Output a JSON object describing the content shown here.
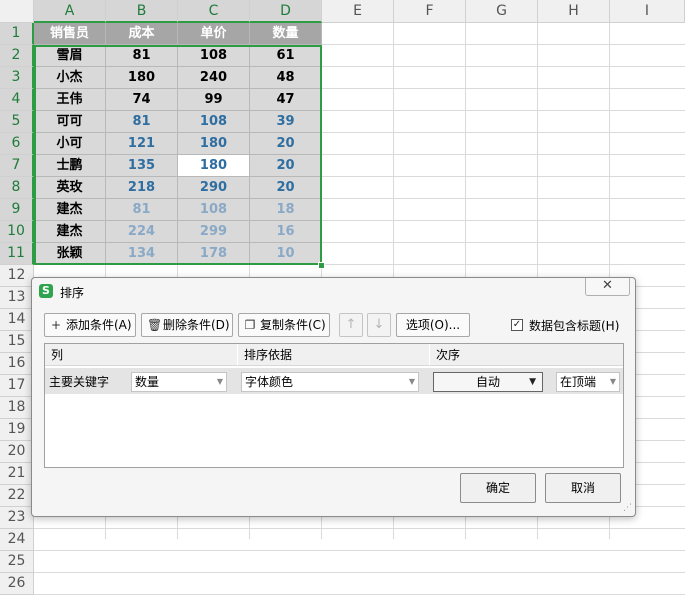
{
  "sheet": {
    "columns": [
      "A",
      "B",
      "C",
      "D",
      "E",
      "F",
      "G",
      "H",
      "I"
    ],
    "rows": [
      "1",
      "2",
      "3",
      "4",
      "5",
      "6",
      "7",
      "8",
      "9",
      "10",
      "11",
      "12",
      "13",
      "14",
      "15",
      "16",
      "17",
      "18",
      "19",
      "20",
      "21",
      "22",
      "23",
      "24",
      "25",
      "26"
    ],
    "header": [
      "销售员",
      "成本",
      "单价",
      "数量"
    ],
    "data": [
      {
        "name": "雪眉",
        "cost": "81",
        "price": "108",
        "qty": "61",
        "color": "#000000"
      },
      {
        "name": "小杰",
        "cost": "180",
        "price": "240",
        "qty": "48",
        "color": "#000000"
      },
      {
        "name": "王伟",
        "cost": "74",
        "price": "99",
        "qty": "47",
        "color": "#000000"
      },
      {
        "name": "可可",
        "cost": "81",
        "price": "108",
        "qty": "39",
        "color": "#2f6ea0"
      },
      {
        "name": "小可",
        "cost": "121",
        "price": "180",
        "qty": "20",
        "color": "#2f6ea0"
      },
      {
        "name": "士鹏",
        "cost": "135",
        "price": "180",
        "qty": "20",
        "color": "#2f6ea0"
      },
      {
        "name": "英玫",
        "cost": "218",
        "price": "290",
        "qty": "20",
        "color": "#2f6ea0"
      },
      {
        "name": "建杰",
        "cost": "81",
        "price": "108",
        "qty": "18",
        "color": "#8aa9c6"
      },
      {
        "name": "建杰",
        "cost": "224",
        "price": "299",
        "qty": "16",
        "color": "#8aa9c6"
      },
      {
        "name": "张颖",
        "cost": "134",
        "price": "178",
        "qty": "10",
        "color": "#8aa9c6"
      }
    ],
    "colors": {
      "selection": "#2e9b45",
      "cell_bg": "#d9d9d9",
      "header_bg": "#a6a6a6",
      "active_cell_bg": "#ffffff"
    }
  },
  "dialog": {
    "title": "排序",
    "close_icon": "✕",
    "toolbar": {
      "add": "添加条件(A)",
      "delete": "删除条件(D)",
      "copy": "复制条件(C)",
      "options": "选项(O)...",
      "has_header_label": "数据包含标题(H)",
      "has_header_checked": true
    },
    "list_headers": {
      "column": "列",
      "sort_on": "排序依据",
      "order": "次序"
    },
    "condition": {
      "label": "主要关键字",
      "column_value": "数量",
      "sort_on_value": "字体颜色",
      "order_value": "自动",
      "position_value": "在顶端"
    },
    "ok": "确定",
    "cancel": "取消"
  }
}
